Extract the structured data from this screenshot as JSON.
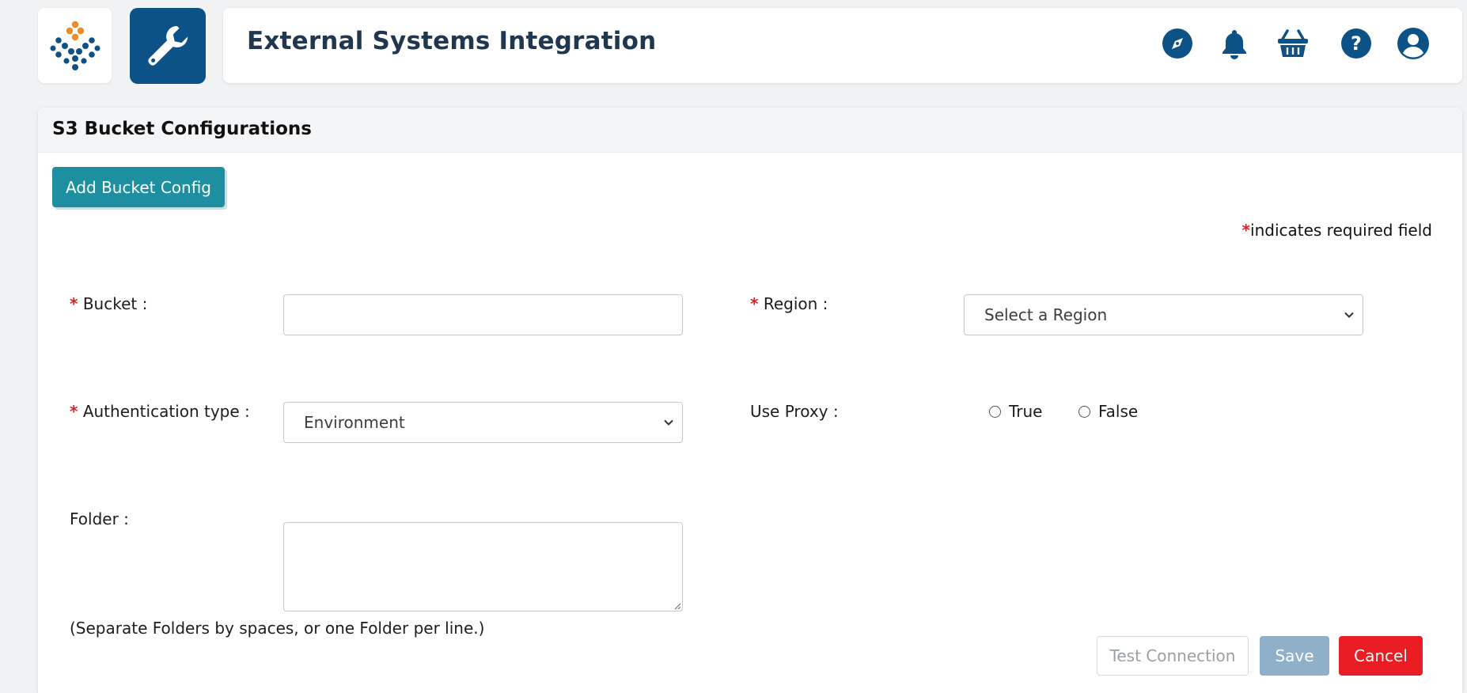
{
  "app": {
    "logo_icon": "app-logo-icon",
    "module_icon": "wrench-icon",
    "title": "External Systems Integration",
    "header_icons": [
      "compass-icon",
      "bell-icon",
      "basket-icon",
      "help-icon",
      "user-icon"
    ],
    "colors": {
      "primary": "#0d5287",
      "accent": "#1e8fa0",
      "danger": "#ea1c24",
      "logo_orange": "#f08a24"
    }
  },
  "card": {
    "title": "S3 Bucket Configurations",
    "add_button_label": "Add Bucket Config",
    "required_star": "*",
    "required_note": "indicates required field"
  },
  "form": {
    "bucket": {
      "label": "Bucket :",
      "value": ""
    },
    "region": {
      "label": "Region :",
      "selected": "Select a Region"
    },
    "auth_type": {
      "label": "Authentication type :",
      "selected": "Environment"
    },
    "use_proxy": {
      "label": "Use Proxy :",
      "options": [
        "True",
        "False"
      ]
    },
    "folder": {
      "label": "Folder :",
      "value": "",
      "hint": "(Separate Folders by spaces, or one Folder per line.)"
    }
  },
  "actions": {
    "test_connection": "Test Connection",
    "save": "Save",
    "cancel": "Cancel"
  }
}
